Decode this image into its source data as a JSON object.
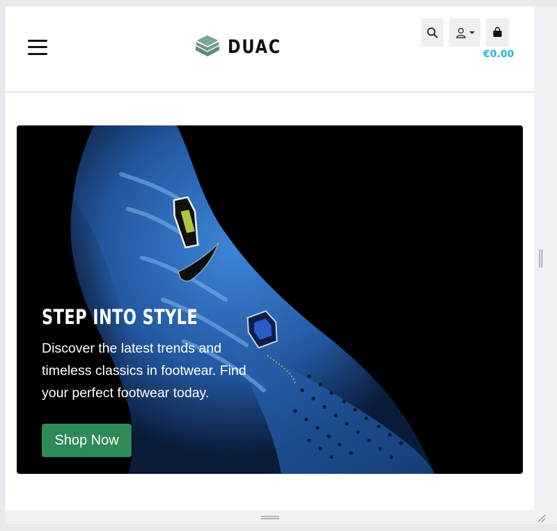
{
  "header": {
    "brand": "DUAC",
    "cart_total": "€0.00",
    "icons": {
      "menu": "hamburger-icon",
      "logo": "layers-icon",
      "search": "search-icon",
      "account": "user-icon",
      "account_caret": "caret-down-icon",
      "cart": "shopping-bag-icon"
    }
  },
  "hero": {
    "title": "STEP INTO STYLE",
    "text": "Discover the latest trends and timeless classics in footwear. Find your perfect footwear today.",
    "button_label": "Shop Now",
    "image": "blue-sneaker-photo"
  },
  "colors": {
    "accent_price": "#27b6d4",
    "button_green": "#2e8a57",
    "logo_green": "#5f8a78",
    "hero_background": "#000000",
    "sneaker_blue": "#2e6fc0"
  }
}
